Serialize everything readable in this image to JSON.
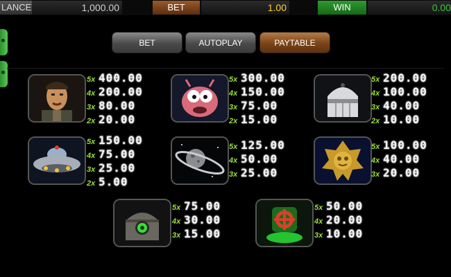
{
  "topbar": {
    "balance_label": "LANCE",
    "balance_value": "1,000.00",
    "bet_label": "BET",
    "bet_value": "1.00",
    "win_label": "WIN",
    "win_value": "0.00"
  },
  "tabs": [
    {
      "label": "BET",
      "active": false
    },
    {
      "label": "AUTOPLAY",
      "active": false
    },
    {
      "label": "PAYTABLE",
      "active": true
    }
  ],
  "symbols": [
    {
      "icon": "soldier-icon",
      "payouts": [
        {
          "mult": "5x",
          "amount": "400.00"
        },
        {
          "mult": "4x",
          "amount": "200.00"
        },
        {
          "mult": "3x",
          "amount": "80.00"
        },
        {
          "mult": "2x",
          "amount": "20.00"
        }
      ]
    },
    {
      "icon": "pink-alien-icon",
      "payouts": [
        {
          "mult": "5x",
          "amount": "300.00"
        },
        {
          "mult": "4x",
          "amount": "150.00"
        },
        {
          "mult": "3x",
          "amount": "75.00"
        },
        {
          "mult": "2x",
          "amount": "15.00"
        }
      ]
    },
    {
      "icon": "robot-helmet-icon",
      "payouts": [
        {
          "mult": "5x",
          "amount": "200.00"
        },
        {
          "mult": "4x",
          "amount": "100.00"
        },
        {
          "mult": "3x",
          "amount": "40.00"
        },
        {
          "mult": "2x",
          "amount": "10.00"
        }
      ]
    },
    {
      "icon": "ufo-icon",
      "payouts": [
        {
          "mult": "5x",
          "amount": "150.00"
        },
        {
          "mult": "4x",
          "amount": "75.00"
        },
        {
          "mult": "3x",
          "amount": "25.00"
        },
        {
          "mult": "2x",
          "amount": "5.00"
        }
      ]
    },
    {
      "icon": "ringed-planet-icon",
      "payouts": [
        {
          "mult": "5x",
          "amount": "125.00"
        },
        {
          "mult": "4x",
          "amount": "50.00"
        },
        {
          "mult": "3x",
          "amount": "25.00"
        }
      ]
    },
    {
      "icon": "gold-badge-icon",
      "payouts": [
        {
          "mult": "5x",
          "amount": "100.00"
        },
        {
          "mult": "4x",
          "amount": "40.00"
        },
        {
          "mult": "3x",
          "amount": "20.00"
        }
      ]
    },
    {
      "icon": "green-eye-pod-icon",
      "payouts": [
        {
          "mult": "5x",
          "amount": "75.00"
        },
        {
          "mult": "4x",
          "amount": "30.00"
        },
        {
          "mult": "3x",
          "amount": "15.00"
        }
      ]
    },
    {
      "icon": "green-target-icon",
      "payouts": [
        {
          "mult": "5x",
          "amount": "50.00"
        },
        {
          "mult": "4x",
          "amount": "20.00"
        },
        {
          "mult": "3x",
          "amount": "10.00"
        }
      ]
    }
  ]
}
